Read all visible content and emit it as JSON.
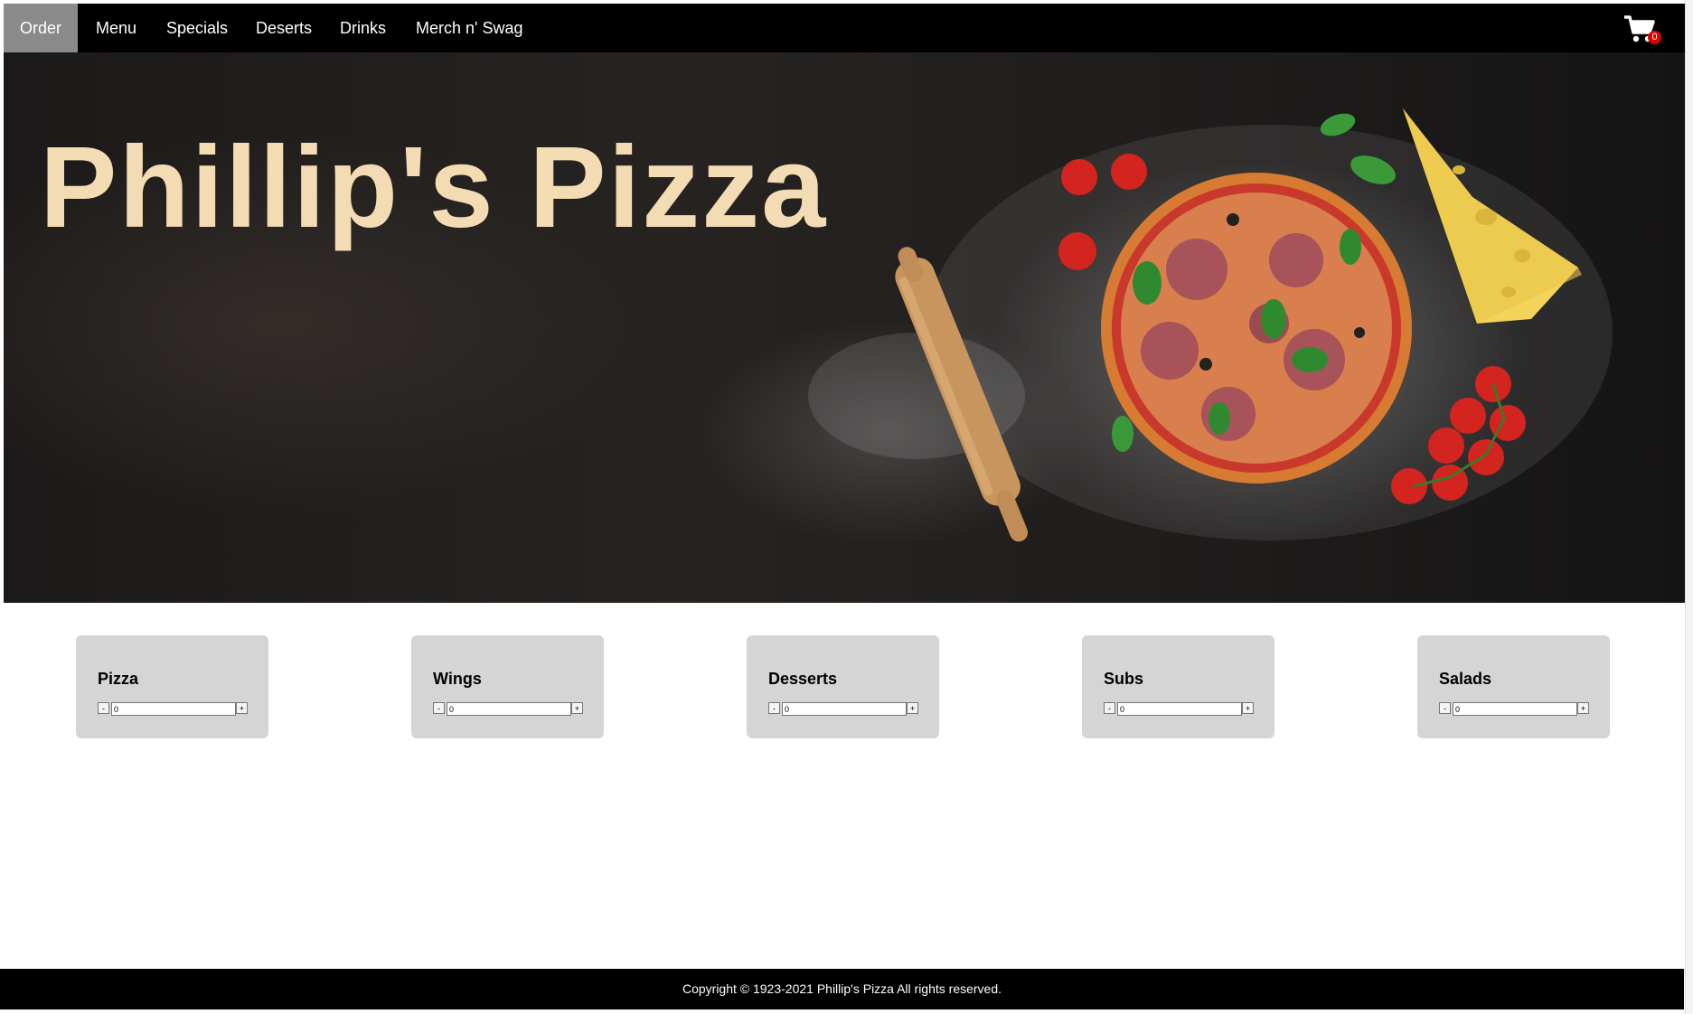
{
  "nav": {
    "items": [
      {
        "label": "Order",
        "active": true
      },
      {
        "label": "Menu",
        "active": false
      },
      {
        "label": "Specials",
        "active": false
      },
      {
        "label": "Deserts",
        "active": false
      },
      {
        "label": "Drinks",
        "active": false
      },
      {
        "label": "Merch n' Swag",
        "active": false
      }
    ],
    "cart": {
      "icon": "shopping-cart-icon",
      "count": "0"
    }
  },
  "hero": {
    "title": "Phillip's Pizza",
    "title_color": "#f3dcb3"
  },
  "categories": [
    {
      "label": "Pizza",
      "quantity": "0",
      "minus": "-",
      "plus": "+"
    },
    {
      "label": "Wings",
      "quantity": "0",
      "minus": "-",
      "plus": "+"
    },
    {
      "label": "Desserts",
      "quantity": "0",
      "minus": "-",
      "plus": "+"
    },
    {
      "label": "Subs",
      "quantity": "0",
      "minus": "-",
      "plus": "+"
    },
    {
      "label": "Salads",
      "quantity": "0",
      "minus": "-",
      "plus": "+"
    }
  ],
  "footer": {
    "text": "Copyright © 1923-2021 Phillip's Pizza All rights reserved."
  }
}
